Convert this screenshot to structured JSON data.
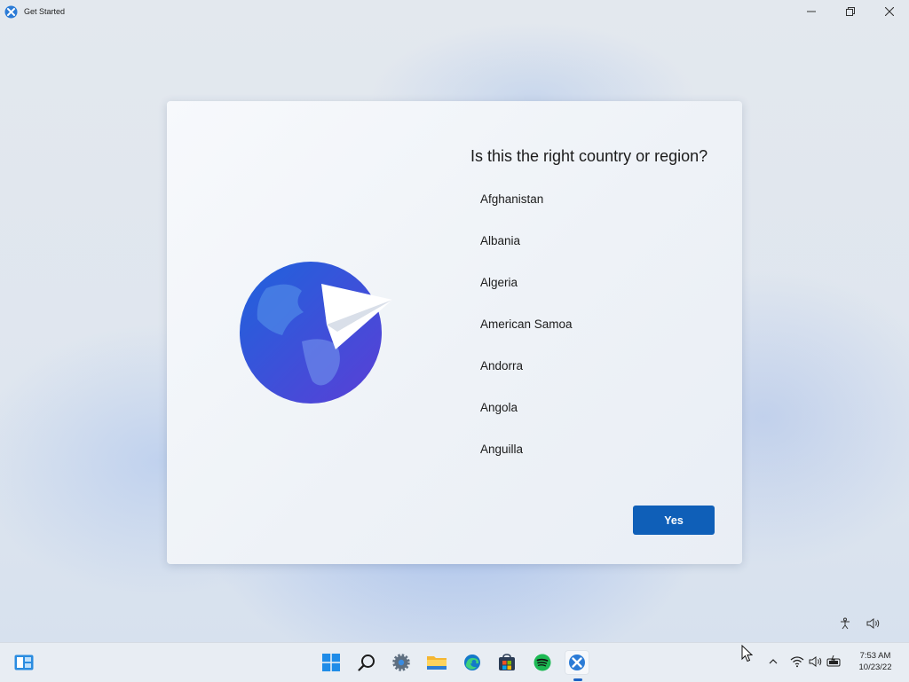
{
  "window": {
    "title": "Get Started",
    "icons": {
      "app": "get-started-icon",
      "minimize": "minimize-icon",
      "maximize": "restore-icon",
      "close": "close-icon"
    }
  },
  "dialog": {
    "question": "Is this the right country or region?",
    "countries": [
      "Afghanistan",
      "Albania",
      "Algeria",
      "American Samoa",
      "Andorra",
      "Angola",
      "Anguilla"
    ],
    "confirm_label": "Yes",
    "illustration": "globe-paper-plane-icon",
    "accent": "#0f5fb8"
  },
  "quick_icons": [
    "accessibility-icon",
    "volume-icon"
  ],
  "taskbar": {
    "apps": [
      "widgets-icon",
      "start-icon",
      "search-icon",
      "settings-icon",
      "file-explorer-icon",
      "edge-icon",
      "store-icon",
      "spotify-icon",
      "get-started-icon"
    ],
    "tray": [
      "chevron-up-icon",
      "wifi-icon",
      "volume-icon",
      "battery-icon"
    ],
    "clock": {
      "time": "7:53 AM",
      "date": "10/23/22"
    }
  }
}
